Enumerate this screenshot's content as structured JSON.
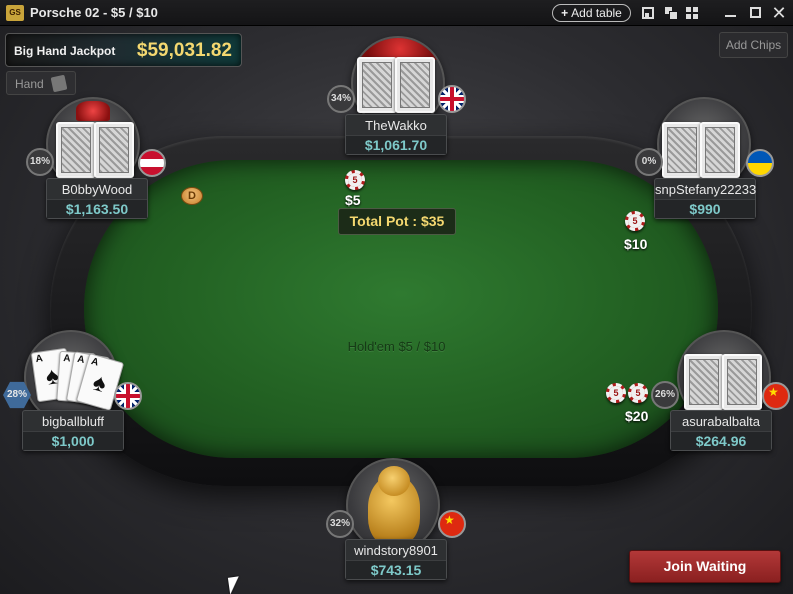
{
  "window": {
    "logo_text": "GS",
    "title": "Porsche 02 - $5 / $10",
    "add_table_label": "Add table"
  },
  "jackpot": {
    "label": "Big Hand Jackpot",
    "value": "$59,031.82"
  },
  "hand_button_label": "Hand",
  "add_chips_label": "Add Chips",
  "table": {
    "game_label": "Hold'em $5 / $10",
    "total_pot": "Total Pot : $35",
    "dealer_button": "D"
  },
  "players": [
    {
      "name": "TheWakko",
      "stack": "$1,061.70",
      "percent": "34%",
      "flag": "gb",
      "bet": "$5"
    },
    {
      "name": "B0bbyWood",
      "stack": "$1,163.50",
      "percent": "18%",
      "flag": "at"
    },
    {
      "name": "snpStefany22233",
      "stack": "$990",
      "percent": "0%",
      "flag": "ua",
      "bet": "$10"
    },
    {
      "name": "bigballbluff",
      "stack": "$1,000",
      "percent": "28%",
      "flag": "gb"
    },
    {
      "name": "asurabalbalta",
      "stack": "$264.96",
      "percent": "26%",
      "flag": "cn",
      "bet": "$20"
    },
    {
      "name": "windstory8901",
      "stack": "$743.15",
      "percent": "32%",
      "flag": "cn"
    }
  ],
  "chip_value": "5",
  "shown_cards": [
    {
      "rank": "A",
      "suit": "♠"
    },
    {
      "rank": "A",
      "suit": "♠"
    },
    {
      "rank": "A",
      "suit": "♠"
    },
    {
      "rank": "A",
      "suit": "♠"
    }
  ],
  "join_waiting_label": "Join Waiting",
  "colors": {
    "stack_text": "#7ec9c9",
    "pot_text": "#f4d870",
    "felt": "#226022",
    "join_button": "#a02c2c"
  }
}
